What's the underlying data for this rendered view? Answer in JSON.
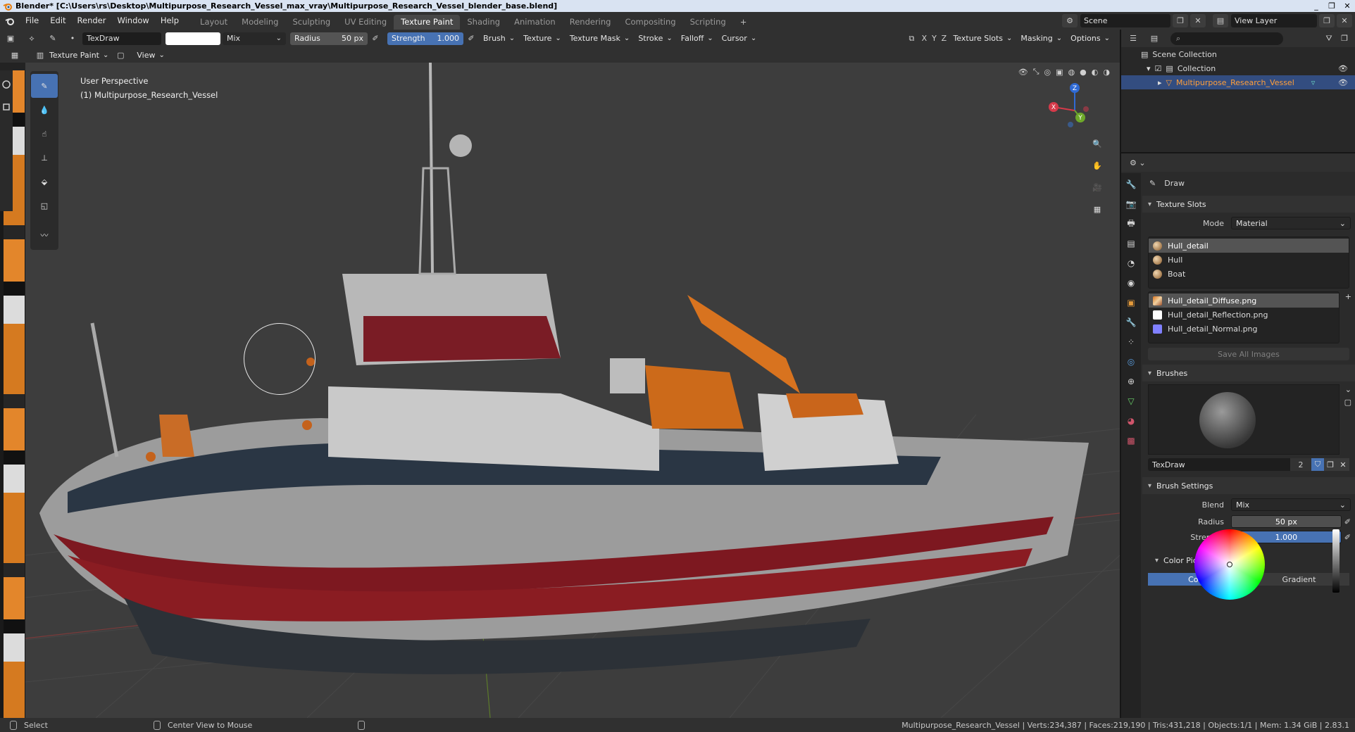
{
  "window": {
    "title": "Blender* [C:\\Users\\rs\\Desktop\\Multipurpose_Research_Vessel_max_vray\\Multipurpose_Research_Vessel_blender_base.blend]",
    "controls": [
      "_",
      "❐",
      "✕"
    ]
  },
  "menu": [
    "File",
    "Edit",
    "Render",
    "Window",
    "Help"
  ],
  "workspaces": {
    "tabs": [
      "Layout",
      "Modeling",
      "Sculpting",
      "UV Editing",
      "Texture Paint",
      "Shading",
      "Animation",
      "Rendering",
      "Compositing",
      "Scripting"
    ],
    "active": "Texture Paint",
    "add": "+"
  },
  "scene": {
    "name": "Scene",
    "view_layer": "View Layer"
  },
  "tool_header": {
    "brush_name": "TexDraw",
    "blend": "Mix",
    "radius_label": "Radius",
    "radius_value": "50 px",
    "strength_label": "Strength",
    "strength_value": "1.000",
    "menus": [
      "Brush",
      "Texture",
      "Texture Mask",
      "Stroke",
      "Falloff",
      "Cursor"
    ],
    "axes": [
      "X",
      "Y",
      "Z"
    ],
    "right_menus": [
      "Texture Slots",
      "Masking",
      "Options"
    ]
  },
  "mode_header": {
    "mode": "Texture Paint",
    "view": "View"
  },
  "viewport": {
    "perspective": "User Perspective",
    "object": "(1) Multipurpose_Research_Vessel",
    "gizmo": {
      "x": "X",
      "y": "Y",
      "z": "Z"
    }
  },
  "status": {
    "select": "Select",
    "center": "Center View to Mouse",
    "stats": "Multipurpose_Research_Vessel | Verts:234,387 | Faces:219,190 | Tris:431,218 | Objects:1/1 | Mem: 1.34 GiB | 2.83.1"
  },
  "outliner": {
    "root": "Scene Collection",
    "collection": "Collection",
    "object": "Multipurpose_Research_Vessel"
  },
  "properties": {
    "tool_name": "Draw",
    "texture_slots": {
      "title": "Texture Slots",
      "mode_label": "Mode",
      "mode_value": "Material",
      "materials": [
        "Hull_detail",
        "Hull",
        "Boat"
      ],
      "images": [
        "Hull_detail_Diffuse.png",
        "Hull_detail_Reflection.png",
        "Hull_detail_Normal.png"
      ],
      "save_all": "Save All Images"
    },
    "brushes": {
      "title": "Brushes",
      "name": "TexDraw",
      "users": "2"
    },
    "brush_settings": {
      "title": "Brush Settings",
      "blend_label": "Blend",
      "blend_value": "Mix",
      "radius_label": "Radius",
      "radius_value": "50 px",
      "strength_label": "Strength",
      "strength_value": "1.000"
    },
    "color_picker": {
      "title": "Color Picker",
      "tab_color": "Color",
      "tab_gradient": "Gradient"
    }
  },
  "colors": {
    "accent": "#4772b3",
    "selected_object": "#ff9f3a",
    "hull_red": "#8a1c22",
    "orange": "#d8731f"
  }
}
